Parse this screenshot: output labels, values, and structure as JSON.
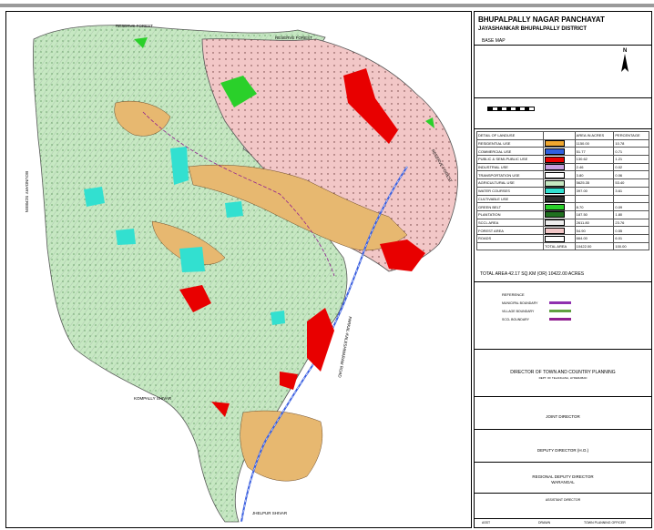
{
  "map": {
    "labels": {
      "reserve_forest_1": "RESERVE FOREST",
      "reserve_forest_2": "RESERVE FOREST",
      "reserve_forest_3": "RESERVE FOREST",
      "boundary_left": "BOUNDARY SCREEN",
      "road_label": "PARKAL-KALESHWARAM ROAD",
      "kompally": "KOMPALLY SHIVAR",
      "jhelpur": "JHELPUR SHIVAR"
    },
    "colors": {
      "agriculture": "#c6e8c2",
      "forest": "#f2c7c7",
      "residential": "#e7b870",
      "public": "#e80000",
      "water": "#32e0d0",
      "green_belt": "#2ad02a",
      "road": "#3a5fe0"
    }
  },
  "legend": {
    "title": "BHUPALPALLY NAGAR PANCHAYAT",
    "subtitle": "JAYASHANKAR BHUPALPALLY  DISTRICT",
    "base_map": "BASE  MAP",
    "north": "N",
    "headers": [
      "DETAIL OF LANDUSE",
      "AREA IN ACRES",
      "PERCENTAGE"
    ],
    "rows": [
      {
        "name": "RESIDENTIAL USE",
        "color": "#f0a830",
        "area": "1150.00",
        "pct": "10.78"
      },
      {
        "name": "COMMERCIAL USE",
        "color": "#3060e0",
        "area": "51.77",
        "pct": "0.71"
      },
      {
        "name": "PUBLIC & SEMI-PUBLIC USE",
        "color": "#e80000",
        "area": "130.62",
        "pct": "1.21"
      },
      {
        "name": "INDUSTRIAL USE",
        "color": "#c8a0e0",
        "area": "2.46",
        "pct": "0.02"
      },
      {
        "name": "TRANSPORTATION USE",
        "color": "#ffffff",
        "area": "3.80",
        "pct": "0.06"
      },
      {
        "name": "AGRICULTURAL USE",
        "color": "#c6e8c2",
        "area": "5625.35",
        "pct": "53.40"
      },
      {
        "name": "WATER COURSES",
        "color": "#32e0d0",
        "area": "397.00",
        "pct": "3.61"
      },
      {
        "name": "CULTIVABLE USE",
        "color": "#303030",
        "area": "",
        "pct": ""
      },
      {
        "name": "GREEN  BELT",
        "color": "#2ad02a",
        "area": "8.70",
        "pct": "0.09"
      },
      {
        "name": "PLANTATION",
        "color": "#207020",
        "area": "187.50",
        "pct": "1.80"
      },
      {
        "name": "SCCL AREA",
        "color": "#eeeeee",
        "area": "2611.80",
        "pct": "23.76"
      },
      {
        "name": "FOREST AREA",
        "color": "#f2c7c7",
        "area": "54.90",
        "pct": "0.55"
      },
      {
        "name": "ROADS",
        "color": "#ffffff",
        "area": "664.00",
        "pct": "6.01"
      }
    ],
    "total_label": "TOTAL AREA",
    "total_area": "10422.00",
    "total_pct": "100.00",
    "total_text": "TOTAL AREA 42.17 SQ.KM (OR) 10422.00 ACRES",
    "reference_title": "REFERENCE",
    "references": [
      {
        "label": "MUNICIPAL BOUNDARY",
        "color": "#9030b0"
      },
      {
        "label": "VILLAGE BOUNDARY",
        "color": "#60a040"
      },
      {
        "label": "SCCL BOUNDARY",
        "color": "#902090"
      }
    ],
    "sig1_title": "DIRECTOR OF TOWN AND COUNTRY PLANNING",
    "sig1_sub": "DEPT. OF TELANGANA, HYDERABAD",
    "sig2": "JOINT DIRECTOR",
    "sig3": "DEPUTY  DIRECTOR (H.O.)",
    "sig4_title": "REGIONAL DEPUTY DIRECTOR",
    "sig4_sub": "WARANGAL",
    "sig5": "ASSISTANT DIRECTOR",
    "foot": [
      "ASST",
      "DRAWN",
      "TOWN PLANNING OFFICER"
    ]
  }
}
